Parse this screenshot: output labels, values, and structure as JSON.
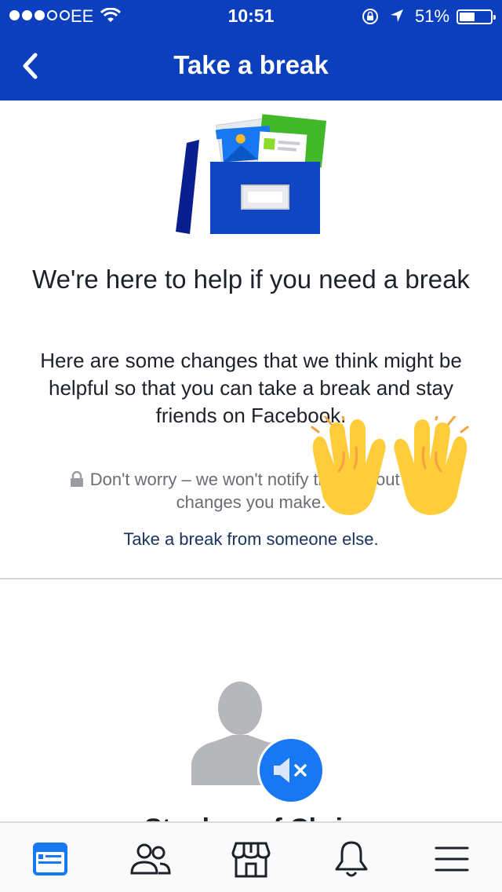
{
  "status_bar": {
    "carrier": "EE",
    "time": "10:51",
    "battery_percent": "51%",
    "battery_level": 0.51,
    "signal_bars_filled": 3,
    "signal_bars_total": 5
  },
  "nav": {
    "title": "Take a break",
    "back_icon": "chevron-left-icon"
  },
  "content": {
    "heading": "We're here to help if you need a break",
    "description": "Here are some changes that we think might be helpful so that you can take a break and stay friends on Facebook.",
    "notice": "Don't worry – we won't notify them about any changes you make.",
    "other_link": "Take a break from someone else."
  },
  "profile": {
    "name_partial": "Stephen of Chris"
  },
  "tabs": [
    {
      "name": "news-feed",
      "icon": "news-feed-icon",
      "active": true
    },
    {
      "name": "friends",
      "icon": "friends-icon",
      "active": false
    },
    {
      "name": "marketplace",
      "icon": "marketplace-icon",
      "active": false
    },
    {
      "name": "notifications",
      "icon": "bell-icon",
      "active": false
    },
    {
      "name": "menu",
      "icon": "menu-icon",
      "active": false
    }
  ],
  "colors": {
    "header_blue": "#0b3fbe",
    "accent_blue": "#1877f2",
    "link_text": "#19335e",
    "emoji_yellow": "#ffcd3a"
  }
}
